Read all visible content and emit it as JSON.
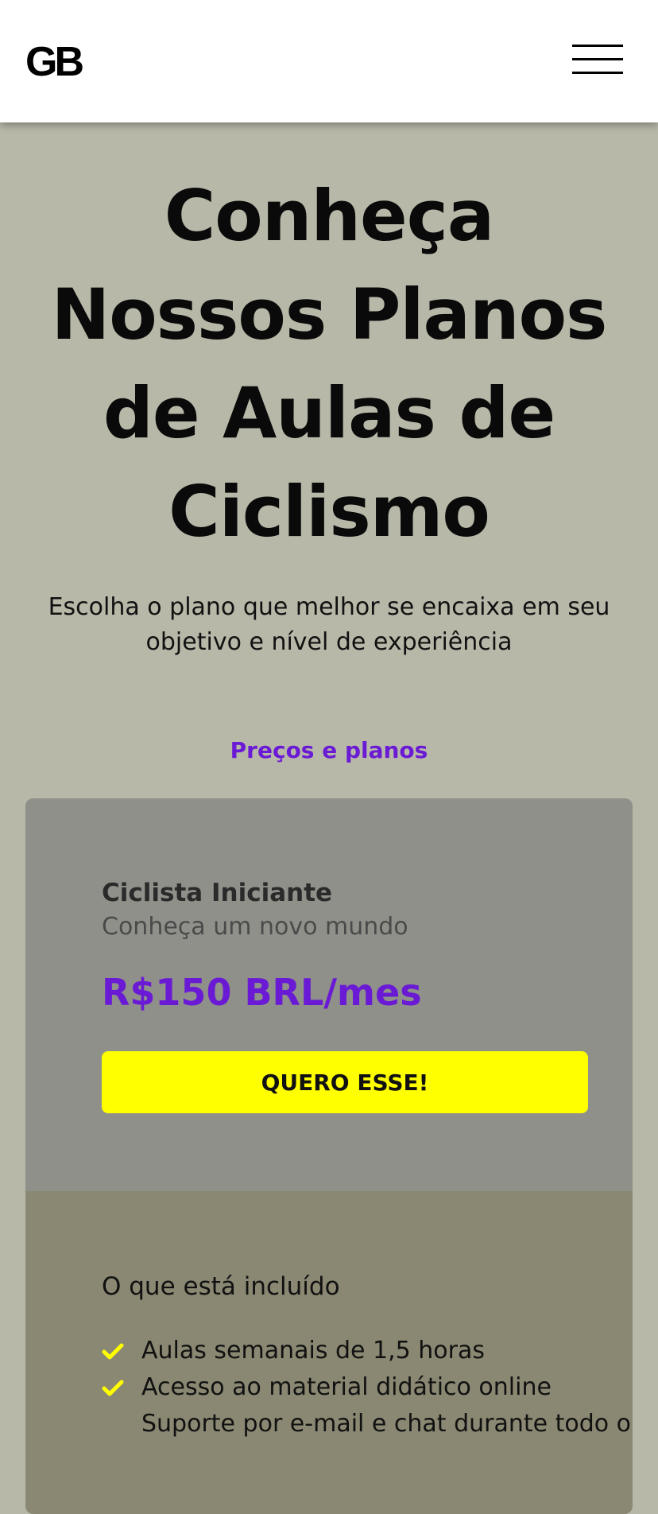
{
  "header": {
    "logo": "GB",
    "menu_icon": "hamburger-menu-icon"
  },
  "hero": {
    "title": "Conheça Nossos Planos de Aulas de Ciclismo",
    "subtitle": "Escolha o plano que melhor se encaixa em seu objetivo e nível de experiência"
  },
  "pricing": {
    "section_label": "Preços e planos"
  },
  "plan": {
    "name": "Ciclista Iniciante",
    "tagline": "Conheça um novo mundo",
    "price": "R$150 BRL/mes",
    "cta_label": "QUERO ESSE!",
    "included_title": "O que está incluído",
    "features": [
      "Aulas semanais de 1,5 horas",
      "Acesso ao material didático online",
      "Suporte por e-mail e chat durante todo o"
    ]
  },
  "colors": {
    "page_background": "#b8b8a9",
    "accent_purple": "#6a1ad4",
    "cta_yellow": "#ffff00",
    "check_yellow": "#ffff00",
    "card_top": "#90908a",
    "card_bottom": "#8a8872"
  }
}
